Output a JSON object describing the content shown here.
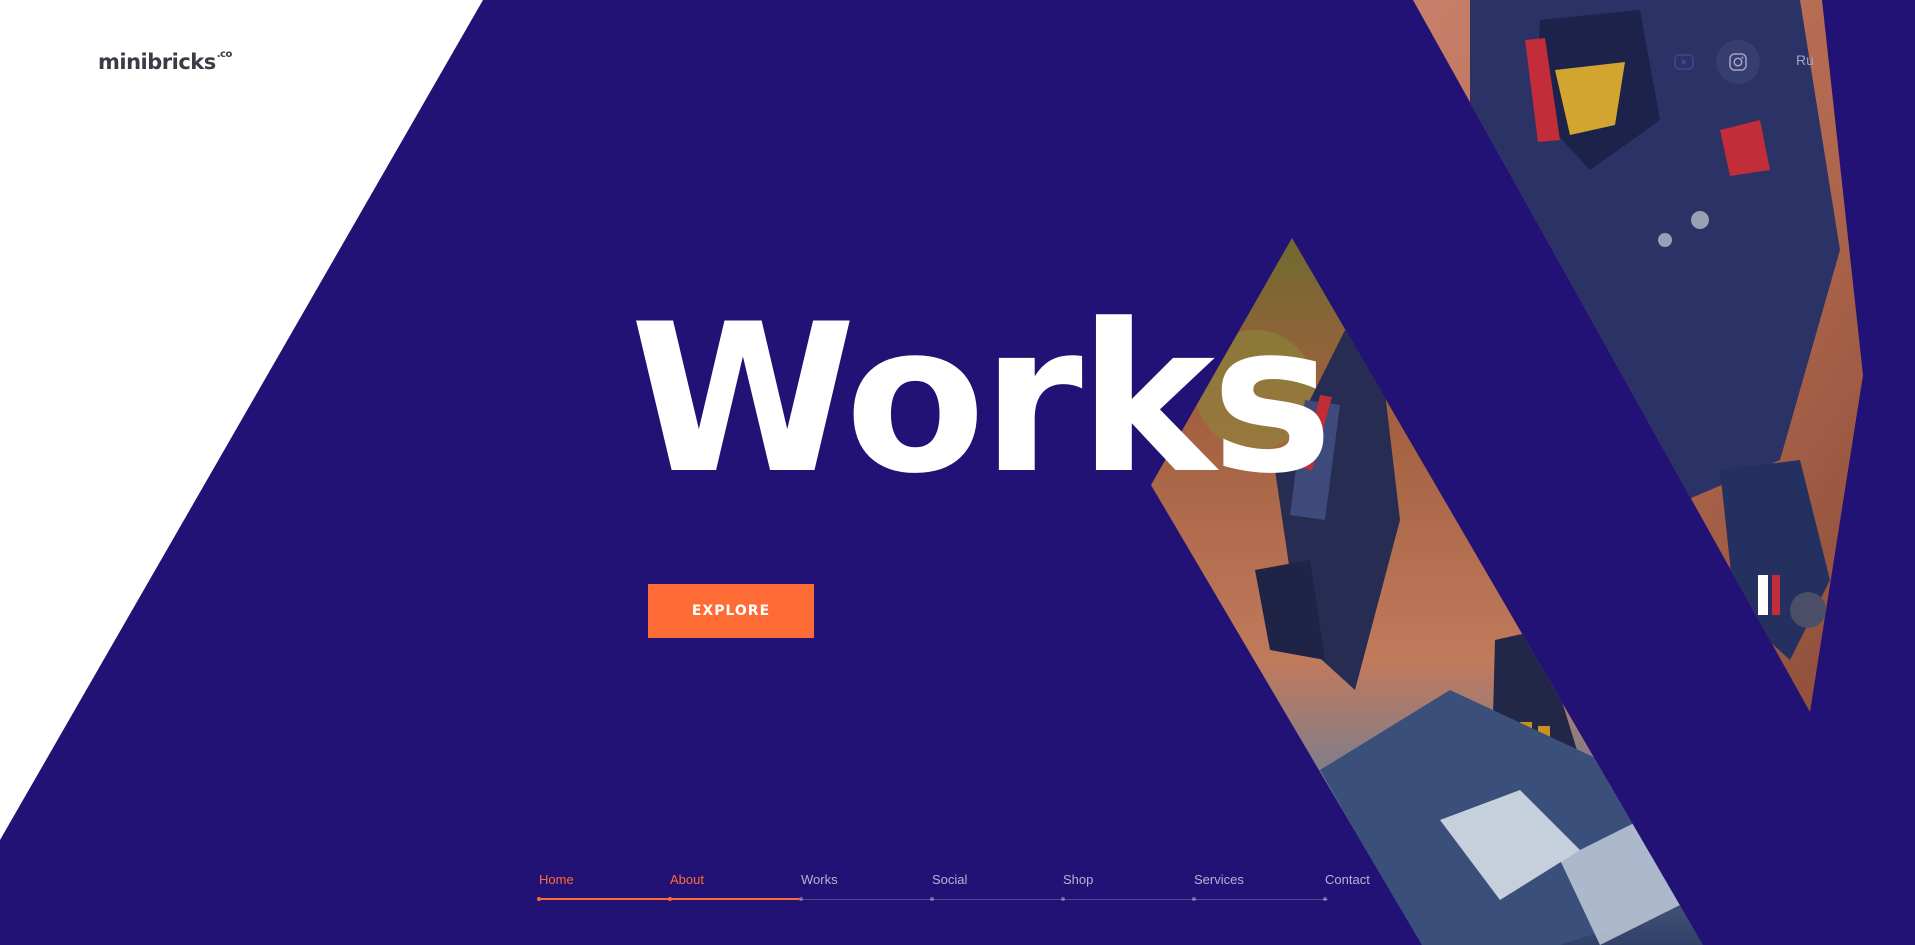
{
  "brand": {
    "logo_text": "minibricks",
    "logo_suffix": ".co"
  },
  "hero": {
    "title": "Works",
    "cta_label": "EXPLORE"
  },
  "header": {
    "social": [
      {
        "name": "youtube-icon"
      },
      {
        "name": "instagram-icon"
      }
    ],
    "language": "Ru"
  },
  "nav": {
    "items": [
      {
        "label": "Home",
        "active": true
      },
      {
        "label": "About",
        "active": true
      },
      {
        "label": "Works",
        "active": false
      },
      {
        "label": "Social",
        "active": false
      },
      {
        "label": "Shop",
        "active": false
      },
      {
        "label": "Services",
        "active": false
      },
      {
        "label": "Contact",
        "active": false
      }
    ],
    "progress": 0.33
  },
  "colors": {
    "background": "#ffffff",
    "hero_panel": "#221275",
    "accent": "#fe6b35",
    "nav_inactive": "#b7b2d6"
  }
}
